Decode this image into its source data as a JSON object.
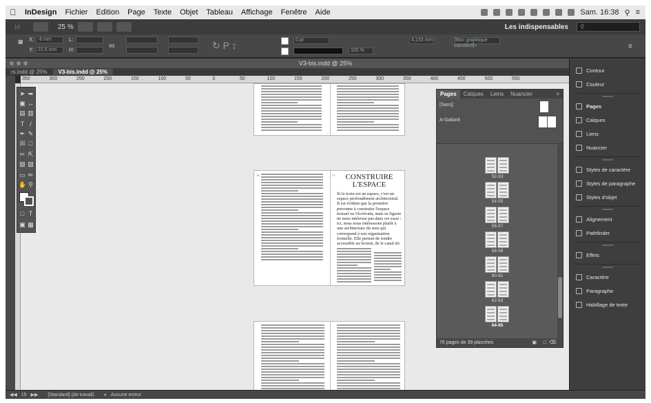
{
  "menubar": {
    "app": "InDesign",
    "items": [
      "Fichier",
      "Edition",
      "Page",
      "Texte",
      "Objet",
      "Tableau",
      "Affichage",
      "Fenêtre",
      "Aide"
    ],
    "clock": "Sam. 16:38"
  },
  "appbar": {
    "logo": "Id",
    "zoom": "25 %",
    "workspace": "Les indispensables",
    "search_placeholder": ""
  },
  "control": {
    "x": "-6 mm",
    "y": "22,6 mm",
    "stroke_weight": "0 pt",
    "opacity": "100 %",
    "dimension": "4,233 mm",
    "frame_style": "[Bloc graphique standard]+"
  },
  "window": {
    "title": "V3-bis.indd @ 25%"
  },
  "tabs": [
    "rs.indd @ 25%",
    "V3-bis.indd @ 25%"
  ],
  "ruler": [
    "350",
    "300",
    "250",
    "200",
    "150",
    "100",
    "50",
    "0",
    "50",
    "100",
    "150",
    "200",
    "250",
    "300",
    "350",
    "400",
    "450",
    "500",
    "550"
  ],
  "page_title": "CONSTRUIRE\nL'ESPACE",
  "page_numbers": [
    "14",
    "17"
  ],
  "lead_text": "Si le texte est un espace, c'est un espace profondément architectural. Il est évident que la première personne à construire l'espace textuel ou l'écrit­vain, mais se figurer ne nous intéresse pas dans cet essai : ici, nous nous intéressons plutôt à une architecture du sens qui correspond à son organisation formelle. Elle permet de rendre accessible au lecteur, de le canal du texte, son aspect sémantique. C'est au designer graphique de favoriser le rôle d'architecte visuel : c'est lui qui imagine, taille, bâtit et sculpte ce édifice d'encre et de papier ou de code et de lumière.",
  "pages_panel": {
    "tabs": [
      "Pages",
      "Calques",
      "Liens",
      "Nuancier"
    ],
    "masters": [
      "[Sans]",
      "A-Gabarit"
    ],
    "spreads": [
      "52-53",
      "54-55",
      "56-57",
      "58-59",
      "60-61",
      "62-63",
      "64-65"
    ],
    "selected": "64-65",
    "footer": "76 pages de 39 planches"
  },
  "dock": [
    {
      "label": "Contour",
      "icon": "stroke-icon"
    },
    {
      "label": "Couleur",
      "icon": "color-icon"
    },
    {
      "label": "Pages",
      "icon": "pages-icon",
      "bold": true
    },
    {
      "label": "Calques",
      "icon": "layers-icon"
    },
    {
      "label": "Liens",
      "icon": "links-icon"
    },
    {
      "label": "Nuancier",
      "icon": "swatches-icon"
    },
    {
      "label": "Styles de caractère",
      "icon": "char-styles-icon"
    },
    {
      "label": "Styles de paragraphe",
      "icon": "para-styles-icon"
    },
    {
      "label": "Styles d'objet",
      "icon": "object-styles-icon"
    },
    {
      "label": "Alignement",
      "icon": "align-icon"
    },
    {
      "label": "Pathfinder",
      "icon": "pathfinder-icon"
    },
    {
      "label": "Effets",
      "icon": "fx-icon"
    },
    {
      "label": "Caractère",
      "icon": "character-icon"
    },
    {
      "label": "Paragraphe",
      "icon": "paragraph-icon"
    },
    {
      "label": "Habillage de texte",
      "icon": "text-wrap-icon"
    }
  ],
  "status": {
    "page": "15",
    "state": "[Standard] (de travail)",
    "errors": "Aucune erreur"
  }
}
